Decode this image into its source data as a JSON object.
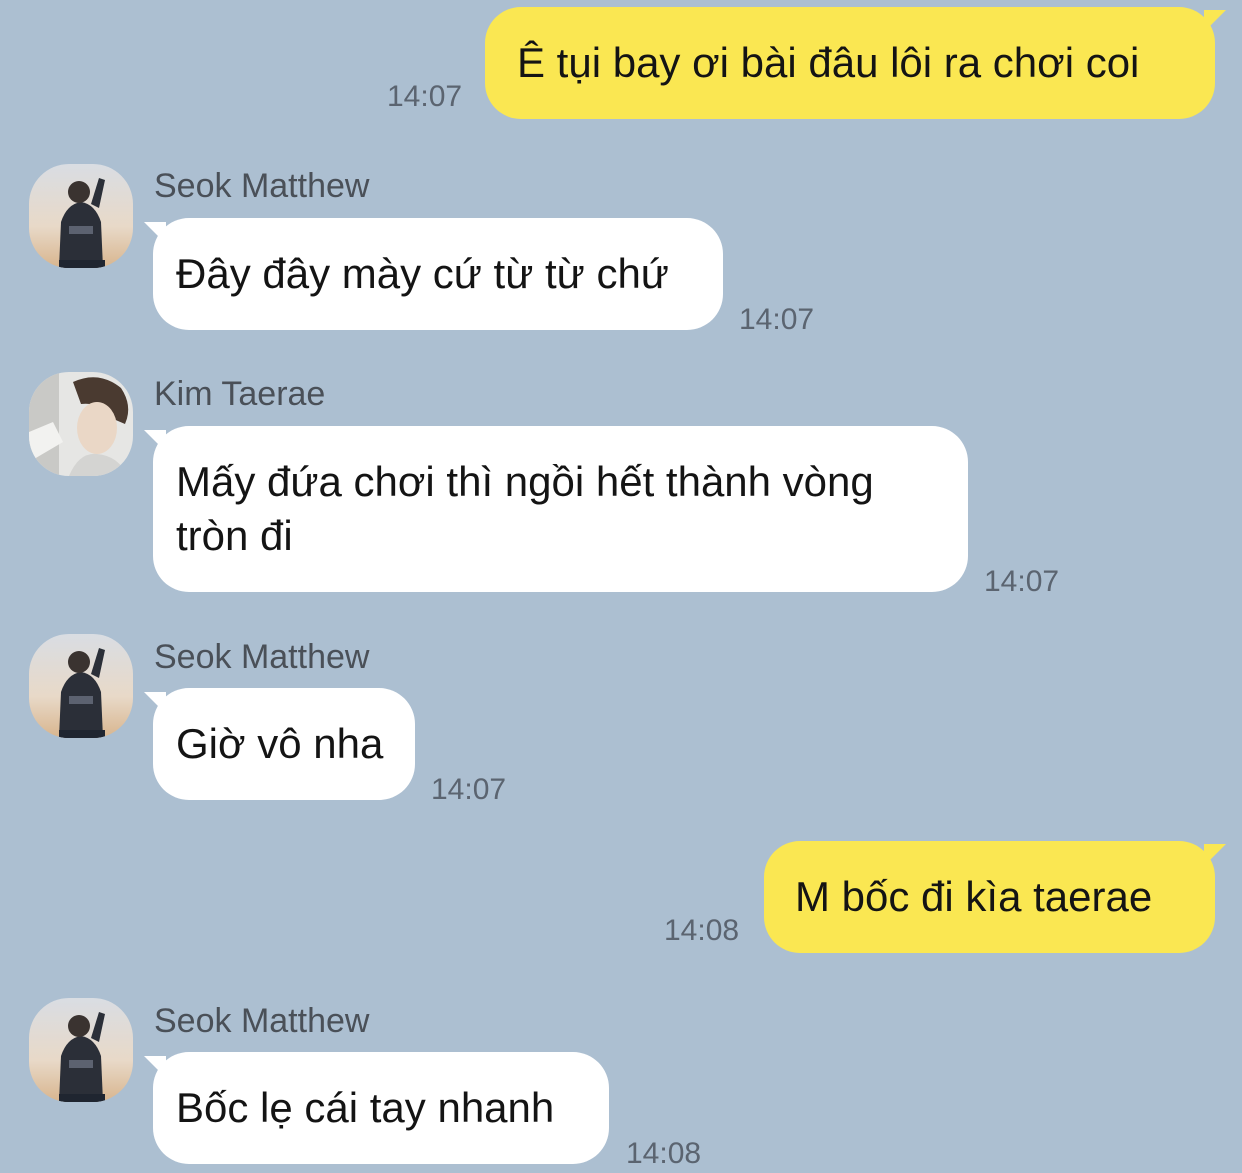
{
  "messages": [
    {
      "text": "Ê tụi bay ơi bài đâu lôi ra chơi coi",
      "time": "14:07"
    },
    {
      "sender": "Seok Matthew",
      "avatar": "person-photo-icon",
      "text": "Đây đây mày cứ từ từ chứ",
      "time": "14:07"
    },
    {
      "sender": "Kim Taerae",
      "avatar": "person-photo-icon",
      "text": "Mấy đứa chơi thì ngồi hết thành vòng tròn đi",
      "time": "14:07"
    },
    {
      "sender": "Seok Matthew",
      "avatar": "person-photo-icon",
      "text": "Giờ vô nha",
      "time": "14:07"
    },
    {
      "text": "M bốc đi kìa taerae",
      "time": "14:08"
    },
    {
      "sender": "Seok Matthew",
      "avatar": "person-photo-icon",
      "text": "Bốc lẹ cái tay nhanh",
      "time": "14:08"
    }
  ],
  "colors": {
    "background": "#acbfd1",
    "outgoing_bubble": "#fae752",
    "incoming_bubble": "#ffffff"
  }
}
